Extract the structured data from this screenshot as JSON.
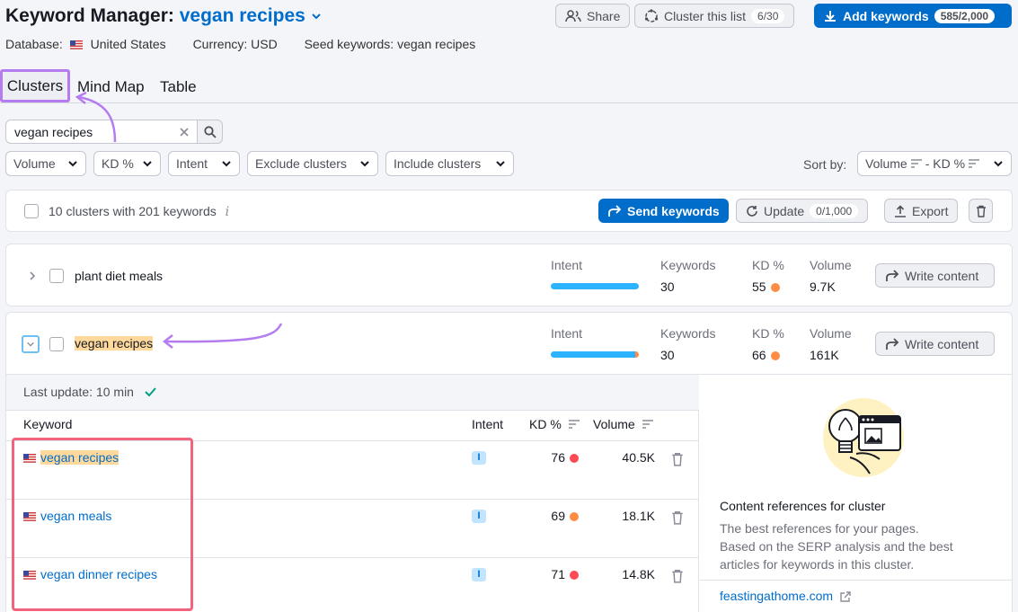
{
  "header": {
    "title_prefix": "Keyword Manager:",
    "list_name": "vegan recipes",
    "share_label": "Share",
    "cluster_label": "Cluster this list",
    "cluster_count": "6/30",
    "add_label": "Add keywords",
    "add_count": "585/2,000"
  },
  "meta": {
    "database_label": "Database:",
    "database_value": "United States",
    "currency": "Currency: USD",
    "seed": "Seed keywords: vegan recipes"
  },
  "tabs": [
    "Clusters",
    "Mind Map",
    "Table"
  ],
  "search": {
    "value": "vegan recipes"
  },
  "filters": [
    "Volume",
    "KD %",
    "Intent",
    "Exclude clusters",
    "Include clusters"
  ],
  "sort": {
    "label": "Sort by:",
    "value": "Volume",
    "value2": "- KD %"
  },
  "toolbar": {
    "summary": "10 clusters with 201 keywords",
    "send_label": "Send keywords",
    "update_label": "Update",
    "update_count": "0/1,000",
    "export_label": "Export"
  },
  "cluster_headers": {
    "intent": "Intent",
    "keywords": "Keywords",
    "kd": "KD %",
    "volume": "Volume",
    "write": "Write content"
  },
  "clusters": [
    {
      "name": "plant diet meals",
      "keywords": "30",
      "kd": "55",
      "volume": "9.7K",
      "kd_color": "#ff8c43"
    },
    {
      "name": "vegan recipes",
      "keywords": "30",
      "kd": "66",
      "volume": "161K",
      "kd_color": "#ff8c43"
    }
  ],
  "detail": {
    "last_update": "Last update: 10 min",
    "columns": {
      "keyword": "Keyword",
      "intent": "Intent",
      "kd": "KD %",
      "volume": "Volume"
    },
    "rows": [
      {
        "keyword": "vegan recipes",
        "intent": "I",
        "kd": "76",
        "volume": "40.5K",
        "kd_color": "#ff4953"
      },
      {
        "keyword": "vegan meals",
        "intent": "I",
        "kd": "69",
        "volume": "18.1K",
        "kd_color": "#ff8c43"
      },
      {
        "keyword": "vegan dinner recipes",
        "intent": "I",
        "kd": "71",
        "volume": "14.8K",
        "kd_color": "#ff4953"
      }
    ]
  },
  "references": {
    "title": "Content references for cluster",
    "desc1": "The best references for your pages.",
    "desc2": "Based on the SERP analysis and the best",
    "desc3": "articles for keywords in this cluster.",
    "link": "feastingathome.com"
  },
  "colors": {
    "accent": "#006dca",
    "annotation_purple": "#b57cf0",
    "annotation_pink": "#f2637e"
  }
}
